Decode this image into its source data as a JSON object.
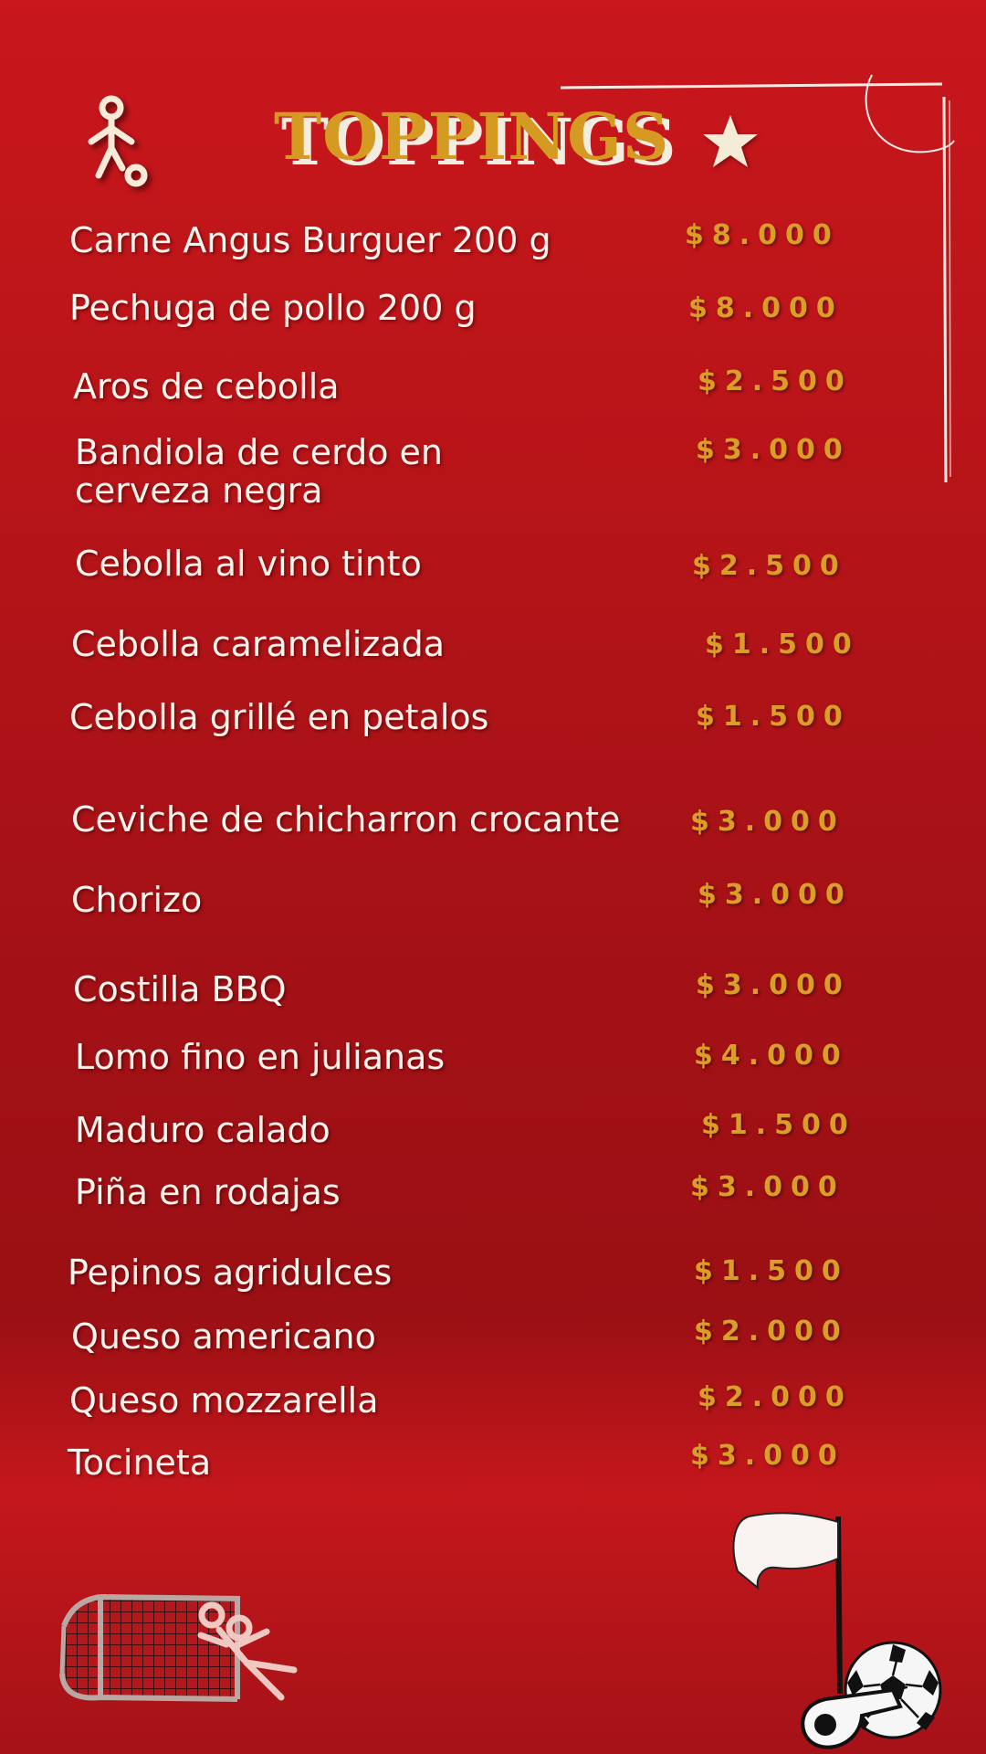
{
  "header": {
    "title": "TOPPINGS"
  },
  "icons": [
    "player-icon",
    "star-icon",
    "soccer-goal-icon",
    "corner-flag-icon",
    "soccer-ball-icon",
    "whistle-icon"
  ],
  "colors": {
    "background": "#b51418",
    "title": "#d59a22",
    "price": "#d89e28",
    "text": "#fbf3ec"
  },
  "menu": {
    "items": [
      {
        "name": "Carne Angus Burguer 200 g",
        "price": "$8.000"
      },
      {
        "name": "Pechuga de pollo 200 g",
        "price": "$8.000"
      },
      {
        "name": "Aros de cebolla",
        "price": "$2.500"
      },
      {
        "name": "Bandiola de cerdo en",
        "name2": "cerveza negra",
        "price": "$3.000"
      },
      {
        "name": "Cebolla al vino tinto",
        "price": "$2.500"
      },
      {
        "name": "Cebolla caramelizada",
        "price": "$1.500"
      },
      {
        "name": "Cebolla grillé en petalos",
        "price": "$1.500"
      },
      {
        "name": "Ceviche de chicharron crocante",
        "price": "$3.000"
      },
      {
        "name": "Chorizo",
        "price": "$3.000"
      },
      {
        "name": "Costilla BBQ",
        "price": "$3.000"
      },
      {
        "name": "Lomo fino en julianas",
        "price": "$4.000"
      },
      {
        "name": "Maduro calado",
        "price": "$1.500"
      },
      {
        "name": "Piña en rodajas",
        "price": "$3.000"
      },
      {
        "name": "Pepinos agridulces",
        "price": "$1.500"
      },
      {
        "name": "Queso americano",
        "price": "$2.000"
      },
      {
        "name": "Queso mozzarella",
        "price": "$2.000"
      },
      {
        "name": "Tocineta",
        "price": "$3.000"
      }
    ]
  }
}
